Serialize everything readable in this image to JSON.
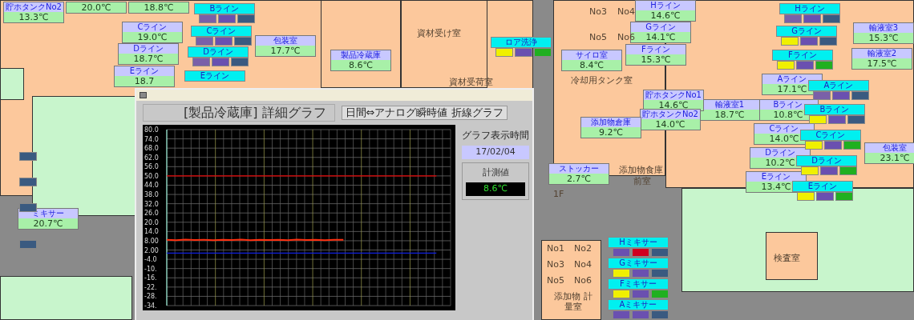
{
  "left_plan": {
    "sensors": [
      {
        "name": "貯ホタンクNo2",
        "value": "13.3℃"
      },
      {
        "value": "20.0℃"
      },
      {
        "value": "18.8℃"
      },
      {
        "name": "Cライン",
        "value": "19.0℃"
      },
      {
        "name": "Dライン",
        "value": "18.7℃"
      },
      {
        "name": "Eライン",
        "value": "18.7"
      },
      {
        "name": "包装室",
        "value": "17.7℃"
      },
      {
        "name": "製品冷蔵庫",
        "value": "8.6℃"
      },
      {
        "name": "ミキサー",
        "value": "20.7℃"
      }
    ],
    "lines": [
      {
        "name": "Bライン",
        "blocks": [
          {
            "color": "#7a60a8"
          },
          {
            "color": "#6a50b0"
          },
          {
            "color": "#3a5a80"
          }
        ]
      },
      {
        "name": "Cライン",
        "blocks": [
          {
            "color": "#7a60a8"
          },
          {
            "color": "#6a50b0"
          },
          {
            "color": "#3a5a80"
          }
        ]
      },
      {
        "name": "Dライン",
        "blocks": [
          {
            "color": "#7a60a8"
          },
          {
            "color": "#6a50b0"
          },
          {
            "color": "#3a5a80"
          }
        ]
      },
      {
        "name": "Eライン"
      },
      {
        "name": "ロア洗浄",
        "blocks": [
          {
            "color": "#f0f000"
          },
          {
            "color": "#6a50b0"
          },
          {
            "color": "#20b020"
          }
        ]
      },
      {
        "blocks": [
          {
            "color": "#3a5a80"
          }
        ]
      },
      {
        "blocks": [
          {
            "color": "#3a5a80"
          }
        ]
      },
      {
        "blocks": [
          {
            "color": "#3a5a80"
          }
        ]
      },
      {
        "blocks": [
          {
            "color": "#3a5a80"
          }
        ]
      }
    ],
    "rooms": [
      {
        "label": "資材受け室"
      },
      {
        "label": "資材受荷室"
      }
    ]
  },
  "right_plan": {
    "sensors": [
      {
        "name": "Hライン",
        "value": "14.6℃"
      },
      {
        "name": "Gライン",
        "value": "14.1℃"
      },
      {
        "name": "Fライン",
        "value": "15.3℃"
      },
      {
        "name": "Aライン",
        "value": "17.1℃"
      },
      {
        "name": "Bライン",
        "value": "10.8℃"
      },
      {
        "name": "Cライン",
        "value": "14.0℃"
      },
      {
        "name": "Dライン",
        "value": "10.2℃"
      },
      {
        "name": "Eライン",
        "value": "13.4℃"
      },
      {
        "name": "輸液室3",
        "value": "15.3℃"
      },
      {
        "name": "輸液室2",
        "value": "17.5℃"
      },
      {
        "name": "輸液室1",
        "value": "18.7℃"
      },
      {
        "name": "包装室",
        "value": "23.1℃"
      },
      {
        "name": "サイロ室",
        "value": "8.4℃"
      },
      {
        "name": "貯ホタンクNo1",
        "value": "14.6℃"
      },
      {
        "name": "貯ホタンクNo2",
        "value": "14.0℃"
      },
      {
        "name": "添加物倉庫",
        "value": "9.2℃"
      },
      {
        "name": "ストッカー",
        "value": "2.7℃"
      }
    ],
    "lines": [
      {
        "name": "Hライン",
        "blocks": [
          {
            "color": "#7a60a8"
          },
          {
            "color": "#6a50b0"
          },
          {
            "color": "#3a5a80"
          }
        ]
      },
      {
        "name": "Gライン",
        "blocks": [
          {
            "color": "#f0f000"
          },
          {
            "color": "#6a50b0"
          },
          {
            "color": "#3a5a80"
          }
        ]
      },
      {
        "name": "Fライン",
        "blocks": [
          {
            "color": "#f0f000"
          },
          {
            "color": "#6a50b0"
          },
          {
            "color": "#20b020"
          }
        ]
      },
      {
        "name": "Aライン",
        "blocks": [
          {
            "color": "#7a60a8"
          },
          {
            "color": "#6a50b0"
          },
          {
            "color": "#3a5a80"
          }
        ]
      },
      {
        "name": "Bライン",
        "blocks": [
          {
            "color": "#f0f000"
          },
          {
            "color": "#6a50b0"
          },
          {
            "color": "#3a5a80"
          }
        ]
      },
      {
        "name": "Cライン",
        "blocks": [
          {
            "color": "#f0f000"
          },
          {
            "color": "#6a50b0"
          },
          {
            "color": "#20b020"
          }
        ]
      },
      {
        "name": "Dライン",
        "blocks": [
          {
            "color": "#f0f000"
          },
          {
            "color": "#6a50b0"
          },
          {
            "color": "#20b020"
          }
        ]
      },
      {
        "name": "Eライン",
        "blocks": [
          {
            "color": "#f0f000"
          },
          {
            "color": "#6a50b0"
          },
          {
            "color": "#20b020"
          }
        ]
      },
      {
        "name": "Hミキサー",
        "blocks": [
          {
            "color": "#6a50b0"
          },
          {
            "color": "#d00020"
          },
          {
            "color": "#3a5a80"
          }
        ]
      },
      {
        "name": "Gミキサー",
        "blocks": [
          {
            "color": "#f0f000"
          },
          {
            "color": "#6a50b0"
          },
          {
            "color": "#3a5a80"
          }
        ]
      },
      {
        "name": "Fミキサー",
        "blocks": [
          {
            "color": "#f0f000"
          },
          {
            "color": "#6a50b0"
          },
          {
            "color": "#20b020"
          }
        ]
      },
      {
        "name": "Aミキサー",
        "blocks": [
          {
            "color": "#6a50b0"
          },
          {
            "color": "#6a50b0"
          },
          {
            "color": "#3a5a80"
          }
        ]
      }
    ],
    "rooms": [
      {
        "label": "No3"
      },
      {
        "label": "No4"
      },
      {
        "label": "No5"
      },
      {
        "label": "No6"
      },
      {
        "label": "冷却用タンク室"
      },
      {
        "label": "添加物食庫"
      },
      {
        "label": "前室"
      },
      {
        "label": "1F"
      },
      {
        "label": "No1"
      },
      {
        "label": "No2"
      },
      {
        "label": "No3"
      },
      {
        "label": "No4"
      },
      {
        "label": "No5"
      },
      {
        "label": "No6"
      },
      {
        "label": "添加物 計量室"
      },
      {
        "label": "検査室"
      }
    ]
  },
  "graph_window": {
    "title": "[製品冷蔵庫] 詳細グラフ",
    "mode": "日間⇔アナログ瞬時値 折線グラフ",
    "time_label": "グラフ表示時間",
    "time": "17/02/04",
    "reading_label": "計測値",
    "reading": "8.6℃",
    "chart_data": {
      "type": "line",
      "grid": true,
      "ylim": [
        -34,
        80
      ],
      "yticks": [
        {
          "value": 80,
          "label": "80.0"
        },
        {
          "value": 74,
          "label": "74.0"
        },
        {
          "value": 68,
          "label": "68.0"
        },
        {
          "value": 62,
          "label": "62.0"
        },
        {
          "value": 56,
          "label": "56.0"
        },
        {
          "value": 50,
          "label": "50.0"
        },
        {
          "value": 44,
          "label": "44.0"
        },
        {
          "value": 38,
          "label": "38.0"
        },
        {
          "value": 32,
          "label": "32.0"
        },
        {
          "value": 26,
          "label": "26.0"
        },
        {
          "value": 20,
          "label": "20.0"
        },
        {
          "value": 14,
          "label": "14.0"
        },
        {
          "value": 8,
          "label": "8.00"
        },
        {
          "value": 2,
          "label": "2.00"
        },
        {
          "value": -4,
          "label": "-4.0"
        },
        {
          "value": -10,
          "label": "-10."
        },
        {
          "value": -16,
          "label": "-16."
        },
        {
          "value": -22,
          "label": "-22."
        },
        {
          "value": -28,
          "label": "-28."
        },
        {
          "value": -34,
          "label": "-34."
        }
      ],
      "series": [
        {
          "color": "#e00000",
          "values": [
            50,
            50,
            50,
            50,
            50,
            50,
            50,
            50,
            50,
            50,
            50,
            50,
            50,
            50,
            50,
            50,
            50,
            50,
            50,
            50,
            50,
            50,
            50,
            50,
            50,
            50,
            50,
            50,
            50,
            50
          ]
        },
        {
          "color": "#ff3010",
          "values": [
            8.6,
            8.4,
            8.7,
            8.5,
            8.6,
            8.4,
            8.6,
            8.5,
            8.7,
            8.4,
            8.6,
            8.5,
            8.6,
            8.4,
            8.7,
            8.5,
            8.6,
            8.4,
            8.6,
            8.6,
            null,
            null,
            null,
            null,
            null,
            null,
            null,
            null,
            null,
            null
          ]
        },
        {
          "color": "#1020e0",
          "values": [
            0,
            0,
            0,
            0,
            0,
            0,
            0,
            0,
            0,
            0,
            0,
            0,
            0,
            0,
            0,
            0,
            0,
            0,
            0,
            0,
            0,
            0,
            0,
            0,
            0,
            0,
            0,
            0,
            0,
            0
          ]
        }
      ]
    }
  }
}
